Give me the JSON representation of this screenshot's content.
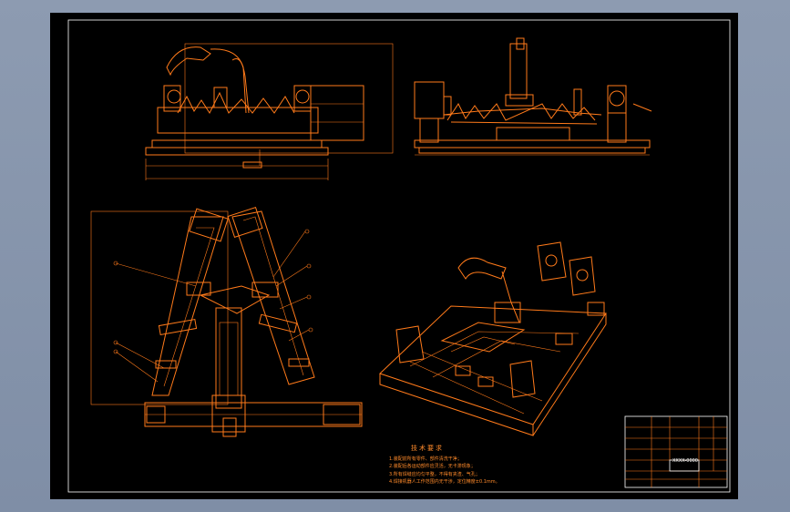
{
  "drawing": {
    "technical_requirements": {
      "title": "技术要求",
      "items": [
        "1.装配前所有零件、部件清洗干净；",
        "2.装配后各运动部件应灵活，无卡滞现象；",
        "3.所有焊缝应均匀平整，不得有夹渣、气孔；",
        "4.焊接机器人工作范围内无干涉，定位精度±0.1mm。"
      ]
    },
    "title_block": {
      "drawing_code": "XXXX-0000"
    },
    "colors": {
      "line": "#ff7a1a",
      "background": "#000000",
      "outer": "#8d9bb1"
    }
  }
}
